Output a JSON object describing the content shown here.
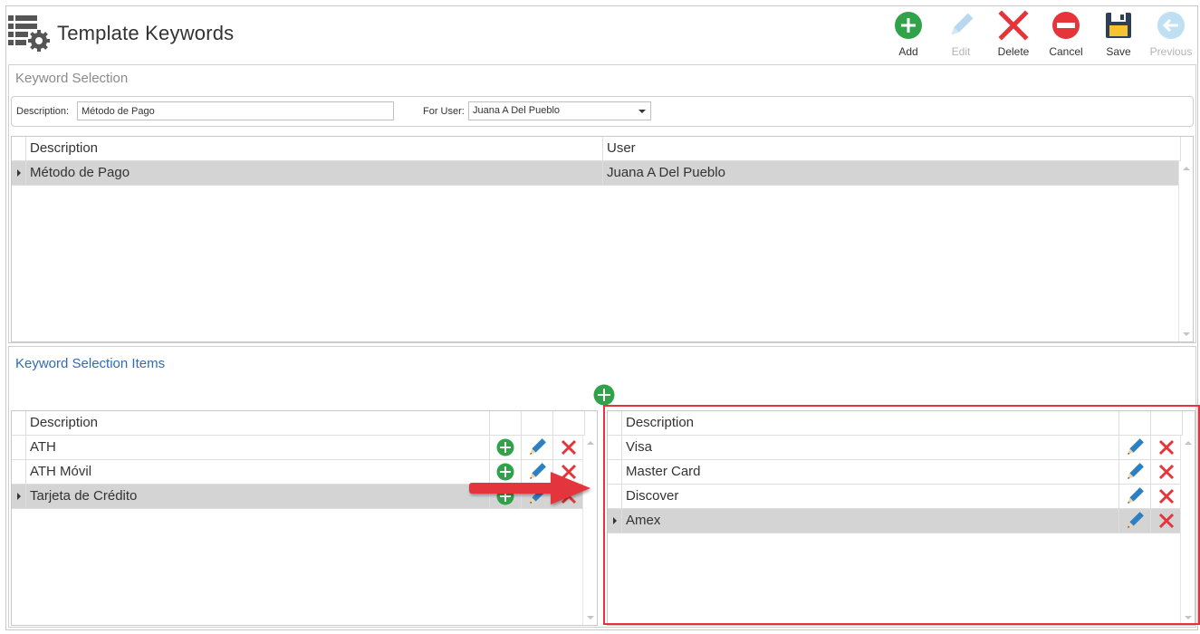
{
  "window": {
    "title": "Template Keywords"
  },
  "toolbar": {
    "buttons": [
      {
        "label": "Add",
        "icon": "add-icon",
        "enabled": true
      },
      {
        "label": "Edit",
        "icon": "edit-icon",
        "enabled": false
      },
      {
        "label": "Delete",
        "icon": "delete-icon",
        "enabled": true
      },
      {
        "label": "Cancel",
        "icon": "cancel-icon",
        "enabled": true
      },
      {
        "label": "Save",
        "icon": "save-icon",
        "enabled": true
      },
      {
        "label": "Previous",
        "icon": "previous-icon",
        "enabled": false
      }
    ]
  },
  "keyword_selection": {
    "title": "Keyword Selection",
    "description_label": "Description:",
    "description_value": "Método de Pago",
    "for_user_label": "For User:",
    "for_user_value": "Juana A Del Pueblo",
    "grid": {
      "columns": [
        "Description",
        "User"
      ],
      "rows": [
        {
          "description": "Método de Pago",
          "user": "Juana A Del Pueblo",
          "selected": true
        }
      ]
    }
  },
  "keyword_items": {
    "title": "Keyword Selection Items",
    "left_grid": {
      "columns": [
        "Description"
      ],
      "rows": [
        {
          "description": "ATH",
          "selected": false
        },
        {
          "description": "ATH Móvil",
          "selected": false
        },
        {
          "description": "Tarjeta de Crédito",
          "selected": true
        }
      ]
    },
    "right_grid": {
      "columns": [
        "Description"
      ],
      "rows": [
        {
          "description": "Visa",
          "selected": false
        },
        {
          "description": "Master Card",
          "selected": false
        },
        {
          "description": "Discover",
          "selected": false
        },
        {
          "description": "Amex",
          "selected": true
        }
      ]
    }
  },
  "colors": {
    "accent_blue": "#2d6db5",
    "add_green": "#2fa24a",
    "delete_red": "#e5353b",
    "pencil_blue": "#2b7fc3",
    "highlight_red": "#e4343e",
    "selected_row": "#d4d4d4"
  }
}
